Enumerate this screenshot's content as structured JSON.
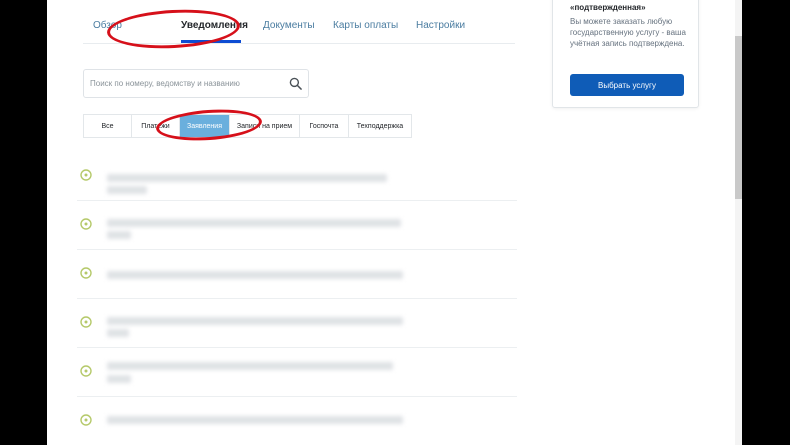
{
  "tabs": [
    {
      "label": "Обзор",
      "active": false
    },
    {
      "label": "Уведомления",
      "active": true
    },
    {
      "label": "Документы",
      "active": false
    },
    {
      "label": "Карты оплаты",
      "active": false
    },
    {
      "label": "Настройки",
      "active": false
    }
  ],
  "search": {
    "placeholder": "Поиск по номеру, ведомству и названию",
    "value": ""
  },
  "filters": [
    {
      "label": "Все",
      "active": false
    },
    {
      "label": "Платежи",
      "active": false
    },
    {
      "label": "Заявления",
      "active": true
    },
    {
      "label": "Записи на прием",
      "active": false
    },
    {
      "label": "Госпочта",
      "active": false
    },
    {
      "label": "Техподдержка",
      "active": false
    }
  ],
  "side_card": {
    "title": "«подтвержденная»",
    "text": "Вы можете заказать любую государственную услугу - ваша учётная запись подтверждена.",
    "button_label": "Выбрать услугу"
  },
  "icons": {
    "search": "search-icon",
    "notification_status": "status-circle-icon"
  },
  "colors": {
    "link": "#4a7ca0",
    "active_tab_underline": "#0d4cd3",
    "active_filter": "#6aafdd",
    "primary_button": "#0f5cb7",
    "status_icon": "#b5c96a",
    "annotation": "#d6101a"
  }
}
